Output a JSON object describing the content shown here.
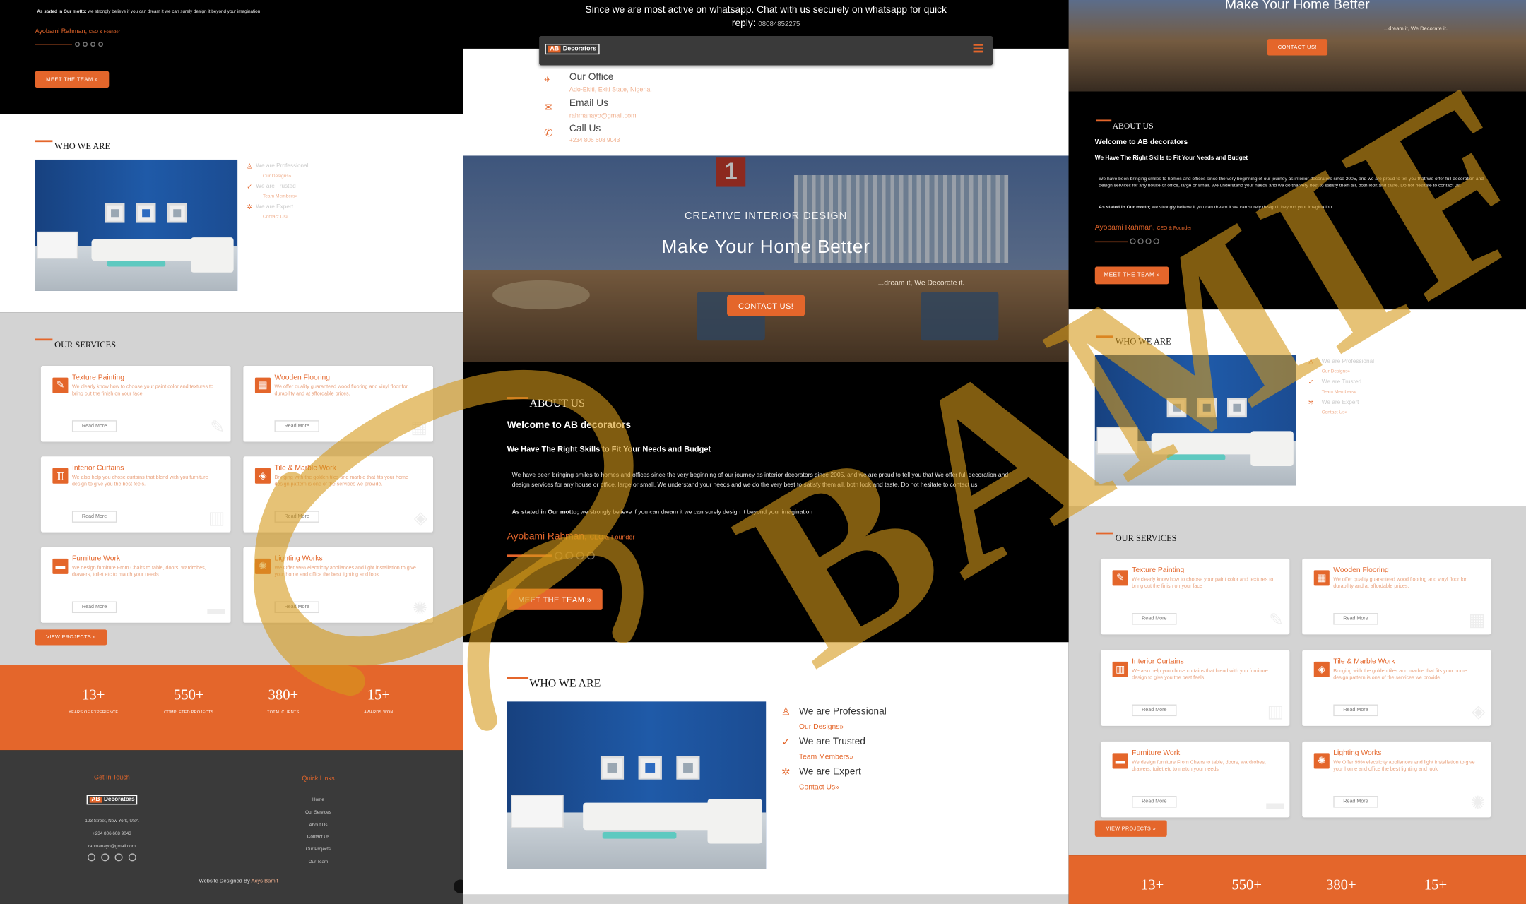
{
  "whatsapp": {
    "text": "Since we are most active on whatsapp. Chat with us securely on whatsapp for quick reply:",
    "number": "08084852275"
  },
  "brand": {
    "logo_ab": "AB",
    "logo_text": "Decorators"
  },
  "contact_bar": {
    "office_title": "Our Office",
    "office_value": "Ado-Ekiti, Ekiti State, Nigeria.",
    "email_title": "Email Us",
    "email_value": "rahmanayo@gmail.com",
    "call_title": "Call Us",
    "call_value": "+234 806 608 9043"
  },
  "hero": {
    "eyebrow": "CREATIVE INTERIOR DESIGN",
    "title": "Make Your Home Better",
    "tagline": "...dream it, We Decorate it.",
    "cta": "CONTACT US!"
  },
  "about": {
    "title": "ABOUT US",
    "welcome": "Welcome to AB decorators",
    "subtitle": "We Have The Right Skills to Fit Your Needs and Budget",
    "body": "We have been bringing smiles to homes and offices since the very beginning of our journey as interior decorators since 2005, and we are proud to tell you that We offer full decoration and design services for any house or office, large or small. We understand your needs and we do the very best to satisfy them all, both look and taste. Do not hesitate to contact us.",
    "motto_label": "As stated in Our motto;",
    "motto_text": "we strongly believe if you can dream it we can surely design it beyond your imagination",
    "founder_name": "Ayobami Rahman,",
    "founder_role": "CEO & Founder",
    "cta": "MEET THE TEAM »"
  },
  "who": {
    "title": "WHO WE ARE",
    "items": [
      {
        "label": "We are Professional",
        "link": "Our Designs»"
      },
      {
        "label": "We are Trusted",
        "link": "Team Members»"
      },
      {
        "label": "We are Expert",
        "link": "Contact Us»"
      }
    ]
  },
  "services": {
    "title": "OUR SERVICES",
    "items": [
      {
        "title": "Texture Painting",
        "desc": "We clearly know how to choose your paint color and textures to bring out the finish on your face",
        "button": "Read More"
      },
      {
        "title": "Wooden Flooring",
        "desc": "We offer quality guaranteed wood flooring and vinyl floor for durability and at affordable prices.",
        "button": "Read More"
      },
      {
        "title": "Interior Curtains",
        "desc": "We also help you chose curtains that blend with you furniture design to give you the best feels.",
        "button": "Read More"
      },
      {
        "title": "Tile & Marble Work",
        "desc": "Bringing with the golden tiles and marble that fits your home design pattern is one of the services we provide.",
        "button": "Read More"
      },
      {
        "title": "Furniture Work",
        "desc": "We design furniture From Chairs to table, doors, wardrobes, drawers, toilet etc to match your needs",
        "button": "Read More"
      },
      {
        "title": "Lighting Works",
        "desc": "We Offer 99% electricity appliances and light installation to give your home and office the best lighting and look",
        "button": "Read More"
      }
    ],
    "cta": "VIEW PROJECTS »"
  },
  "stats": [
    {
      "number": "13+",
      "label": "YEARS OF EXPERIENCE"
    },
    {
      "number": "550+",
      "label": "COMPLETED PROJECTS"
    },
    {
      "number": "380+",
      "label": "TOTAL CLIENTS"
    },
    {
      "number": "15+",
      "label": "AWARDS WON"
    }
  ],
  "footer": {
    "touch_title": "Get In Touch",
    "address": "123 Street, New York, USA",
    "phone": "+234 806 608 9043",
    "email": "rahmanayo@gmail.com",
    "links_title": "Quick Links",
    "links": [
      "Home",
      "Our Services",
      "About Us",
      "Contact Us",
      "Our Projects",
      "Our Team"
    ],
    "credit_prefix": "Website Designed By",
    "credit_name": "Acys Bamif"
  },
  "right_hero": {
    "title": "Make Your Home Better",
    "cta": "CONTACT US!",
    "tagline": "...dream it, We Decorate it."
  },
  "watermark": "Acys BAMIF",
  "colors": {
    "accent": "#e4662b",
    "dark": "#000000",
    "footer": "#3a3a3a",
    "grey": "#d3d3d3"
  }
}
